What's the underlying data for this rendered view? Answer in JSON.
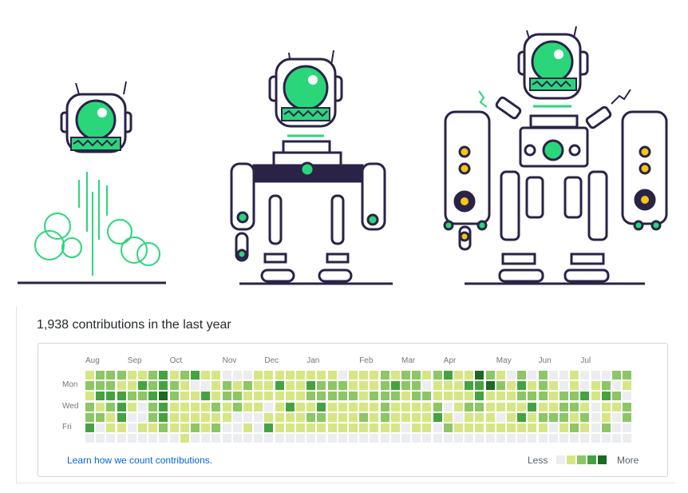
{
  "contributions": {
    "title": "1,938 contributions in the last year",
    "months": [
      "Aug",
      "Sep",
      "Oct",
      "Nov",
      "Dec",
      "Jan",
      "Feb",
      "Mar",
      "Apr",
      "May",
      "Jun",
      "Jul"
    ],
    "month_start_weeks": [
      0,
      4,
      8,
      13,
      17,
      21,
      26,
      30,
      34,
      39,
      43,
      47
    ],
    "day_labels": [
      {
        "row": 1,
        "label": "Mon"
      },
      {
        "row": 3,
        "label": "Wed"
      },
      {
        "row": 5,
        "label": "Fri"
      }
    ],
    "levels": [
      "1222112312311000111111110111212212311421020200100022",
      "2221132321001212113113222111232201113342131210101201",
      "1333223421131221111112222212221221111311122212231320",
      "2123102311112121101311311111211112012211113112210112",
      "2213002311111100011112211121211113101110131222120102",
      "3011011211212001031111111111110110211111111101210200",
      "0000000001000000000000000000000000000000000000000000"
    ],
    "colors": [
      "#ebedf0",
      "#d6e685",
      "#8cc665",
      "#44a340",
      "#1e6823"
    ],
    "link_text": "Learn how we count contributions.",
    "legend_less": "Less",
    "legend_more": "More"
  }
}
